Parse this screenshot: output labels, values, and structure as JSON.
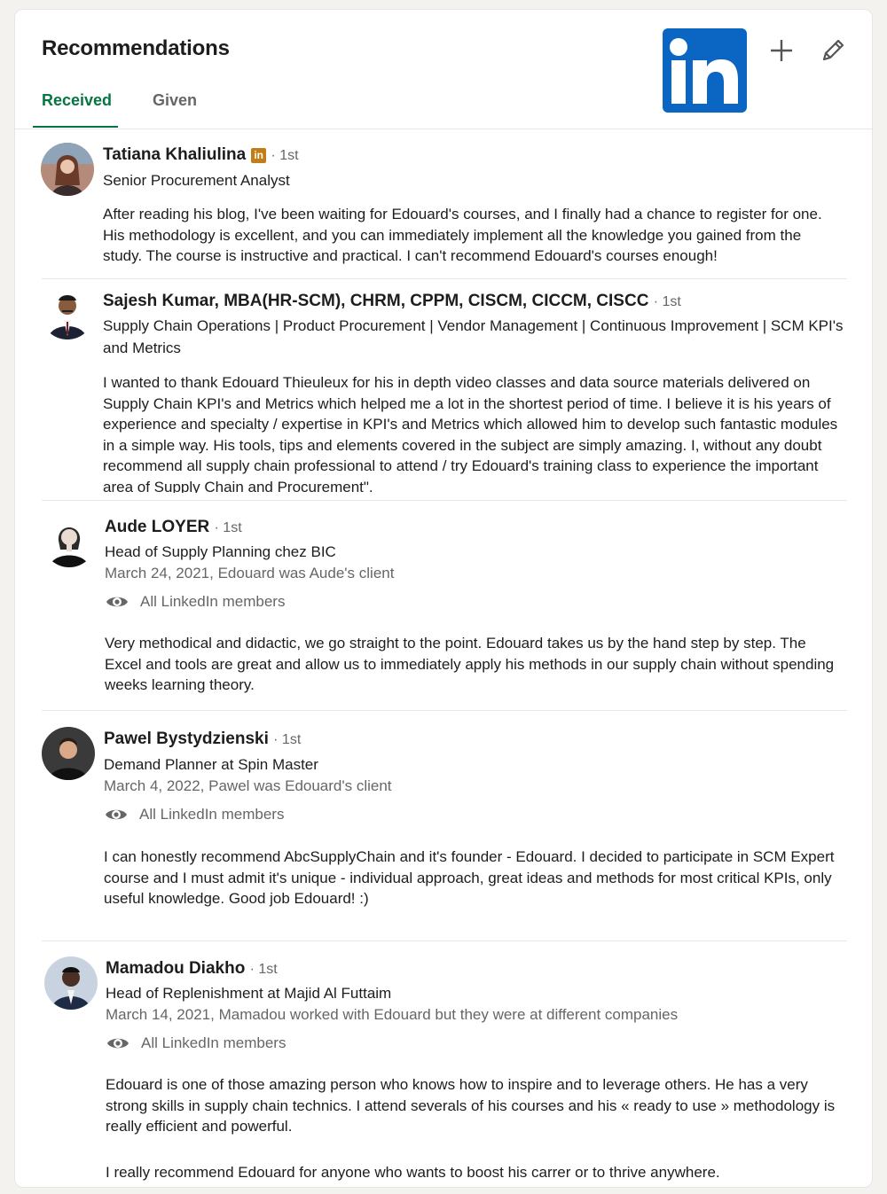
{
  "header": {
    "title": "Recommendations",
    "logo_text": "in",
    "add_icon": "plus-icon",
    "edit_icon": "pencil-icon"
  },
  "tabs": [
    {
      "label": "Received",
      "active": true
    },
    {
      "label": "Given",
      "active": false
    }
  ],
  "colors": {
    "accent": "#057642",
    "brand": "#0a66c2",
    "badge": "#c37d16",
    "muted": "#666666"
  },
  "recommendations": [
    {
      "name": "Tatiana Khaliulina",
      "badge": "in",
      "degree": "· 1st",
      "headline": "Senior Procurement Analyst",
      "text": "After reading his blog, I've been waiting for Edouard's courses, and I finally had a chance to register for one. His methodology is excellent, and you can immediately implement all the knowledge you gained from the study. The course is instructive and practical. I can't recommend Edouard's courses enough!"
    },
    {
      "name": "Sajesh Kumar, MBA(HR-SCM), CHRM, CPPM, CISCM, CICCM, CISCC",
      "degree": "· 1st",
      "headline": "Supply Chain Operations | Product Procurement | Vendor Management | Continuous Improvement | SCM KPI's and Metrics",
      "text": "I wanted to thank Edouard Thieuleux for his in depth video classes and data source materials delivered on Supply Chain KPI's and Metrics which helped me a lot in the shortest period of time. I believe it is his years of experience and specialty / expertise in KPI's and Metrics which allowed him to develop such fantastic modules in a simple way. His tools, tips and elements covered in the subject are simply amazing. I, without any doubt recommend all supply chain professional to attend / try Edouard's training class to experience the important area of Supply Chain and Procurement\"."
    },
    {
      "name": "Aude LOYER",
      "degree": "· 1st",
      "headline": "Head of Supply Planning chez BIC",
      "meta": "March 24, 2021, Edouard was Aude's client",
      "visibility": "All LinkedIn members",
      "text": "Very methodical and didactic, we go straight to the point. Edouard takes us by the hand step by step. The Excel and tools are great and allow us to immediately apply his methods in our supply chain without spending weeks learning theory."
    },
    {
      "name": "Pawel Bystydzienski",
      "degree": "· 1st",
      "headline": "Demand Planner at Spin Master",
      "meta": "March 4, 2022, Pawel was Edouard's client",
      "visibility": "All LinkedIn members",
      "text": "I can honestly recommend AbcSupplyChain and it's founder - Edouard. I decided to participate in SCM Expert course and I must admit it's unique - individual approach, great ideas and methods for most critical KPIs, only useful knowledge. Good job Edouard! :)"
    },
    {
      "name": "Mamadou Diakho",
      "degree": "· 1st",
      "headline": "Head of Replenishment at Majid Al Futtaim",
      "meta": "March 14, 2021, Mamadou worked with Edouard but they were at different companies",
      "visibility": "All LinkedIn members",
      "text": "Edouard is one of those amazing person who knows how to inspire and to leverage others. He has a very strong skills in supply chain technics. I attend severals of his courses and his « ready to use » methodology is really efficient and powerful.",
      "text2": "I really recommend Edouard for anyone who wants to boost his carrer or to thrive anywhere."
    }
  ]
}
